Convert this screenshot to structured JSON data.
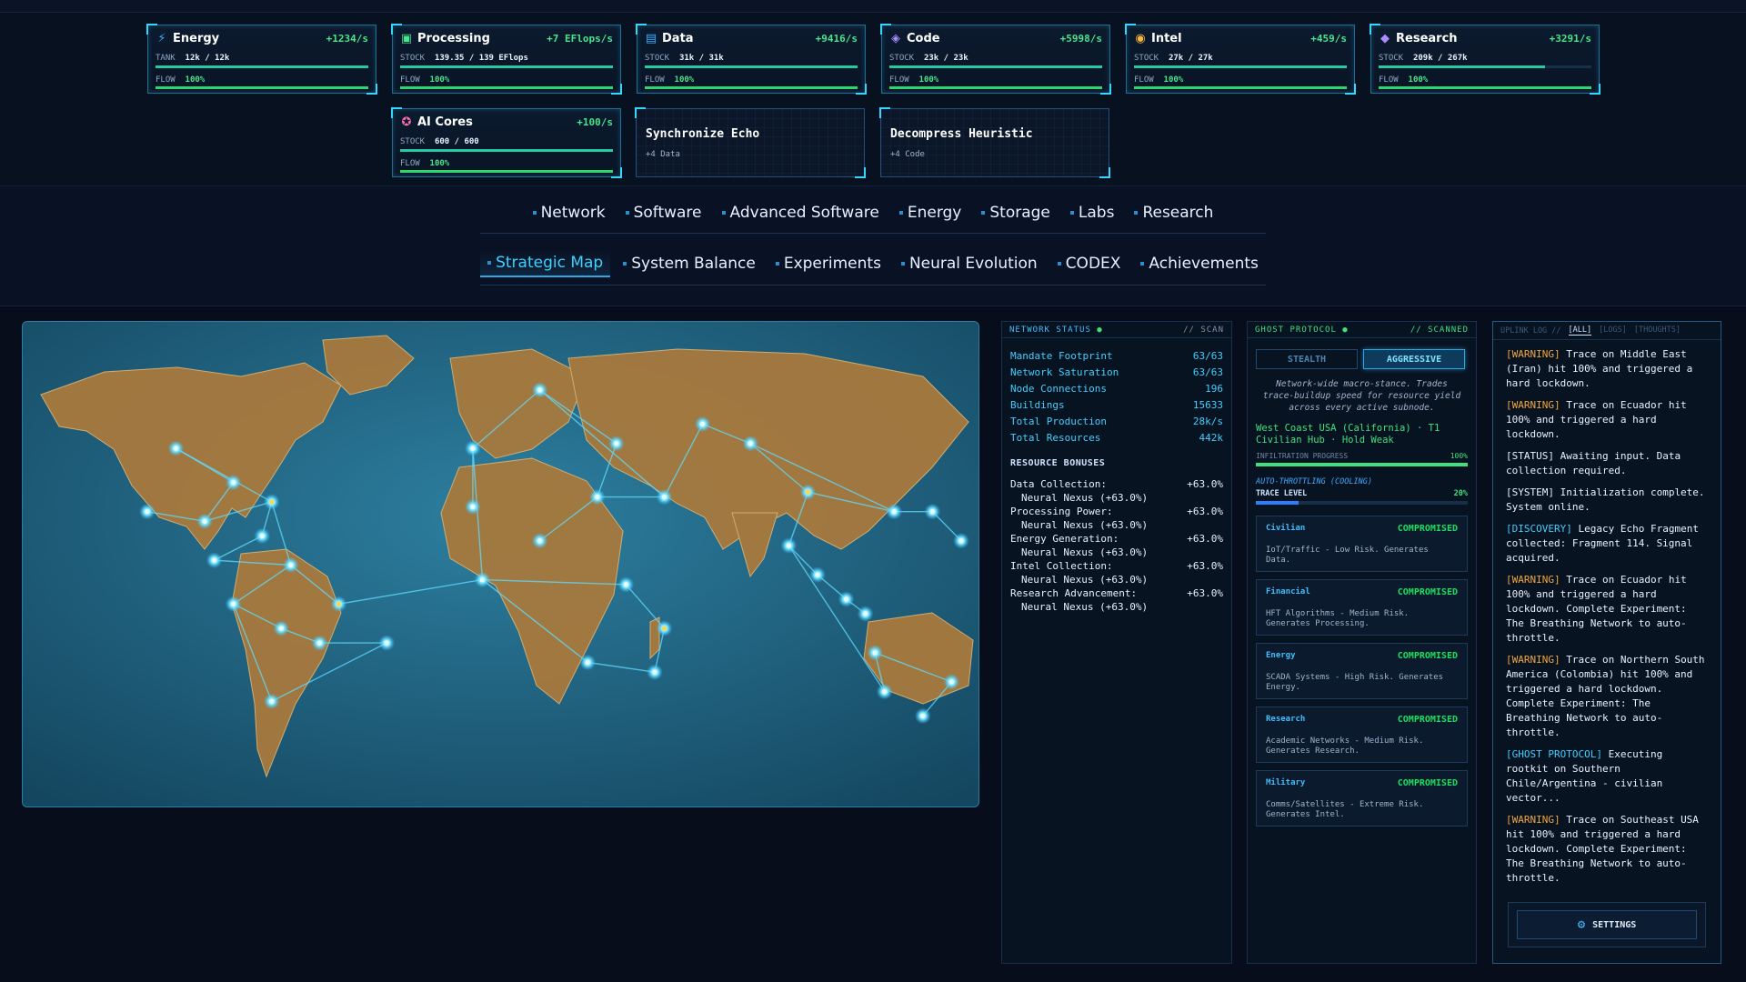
{
  "resources": [
    {
      "name": "Energy",
      "icon": "lightning-icon",
      "glyph": "⚡",
      "color": "#3fa9ff",
      "rate": "+1234/s",
      "stock_label": "TANK",
      "stock": "12k / 12k",
      "fill": 1.0,
      "flow_label": "FLOW",
      "flow": "100%"
    },
    {
      "name": "Processing",
      "icon": "chip-icon",
      "glyph": "▣",
      "color": "#4be38b",
      "rate": "+7 EFlops/s",
      "stock_label": "STOCK",
      "stock": "139.35 / 139 EFlops",
      "fill": 1.0,
      "flow_label": "FLOW",
      "flow": "100%"
    },
    {
      "name": "Data",
      "icon": "window-icon",
      "glyph": "▤",
      "color": "#3fa9ff",
      "rate": "+9416/s",
      "stock_label": "STOCK",
      "stock": "31k / 31k",
      "fill": 1.0,
      "flow_label": "FLOW",
      "flow": "100%"
    },
    {
      "name": "Code",
      "icon": "code-brackets-icon",
      "glyph": "◈",
      "color": "#a98bff",
      "rate": "+5998/s",
      "stock_label": "STOCK",
      "stock": "23k / 23k",
      "fill": 1.0,
      "flow_label": "FLOW",
      "flow": "100%"
    },
    {
      "name": "Intel",
      "icon": "target-icon",
      "glyph": "◉",
      "color": "#f5b93c",
      "rate": "+459/s",
      "stock_label": "STOCK",
      "stock": "27k / 27k",
      "fill": 1.0,
      "flow_label": "FLOW",
      "flow": "100%"
    },
    {
      "name": "Research",
      "icon": "layers-icon",
      "glyph": "◆",
      "color": "#a98bff",
      "rate": "+3291/s",
      "stock_label": "STOCK",
      "stock": "209k / 267k",
      "fill": 0.78,
      "flow_label": "FLOW",
      "flow": "100%"
    },
    {
      "name": "AI Cores",
      "icon": "brain-icon",
      "glyph": "✪",
      "color": "#ff6fb4",
      "rate": "+100/s",
      "stock_label": "STOCK",
      "stock": "600 / 600",
      "fill": 1.0,
      "flow_label": "FLOW",
      "flow": "100%"
    }
  ],
  "experiments": [
    {
      "title": "Synchronize Echo",
      "reward": "+4 Data"
    },
    {
      "title": "Decompress Heuristic",
      "reward": "+4 Code"
    }
  ],
  "nav_primary": [
    "Network",
    "Software",
    "Advanced Software",
    "Energy",
    "Storage",
    "Labs",
    "Research"
  ],
  "nav_secondary": [
    "Strategic Map",
    "System Balance",
    "Experiments",
    "Neural Evolution",
    "CODEX",
    "Achievements"
  ],
  "active_tab": "Strategic Map",
  "network_status": {
    "title": "NETWORK STATUS",
    "tag": "// SCAN",
    "stats": [
      {
        "label": "Mandate Footprint",
        "value": "63/63"
      },
      {
        "label": "Network Saturation",
        "value": "63/63"
      },
      {
        "label": "Node Connections",
        "value": "196"
      },
      {
        "label": "Buildings",
        "value": "15633"
      },
      {
        "label": "Total Production",
        "value": "28k/s"
      },
      {
        "label": "Total Resources",
        "value": "442k"
      }
    ],
    "bonus_title": "RESOURCE BONUSES",
    "bonuses": [
      {
        "label": "Data Collection:",
        "value": "+63.0%",
        "sub": "Neural Nexus (+63.0%)"
      },
      {
        "label": "Processing Power:",
        "value": "+63.0%",
        "sub": "Neural Nexus (+63.0%)"
      },
      {
        "label": "Energy Generation:",
        "value": "+63.0%",
        "sub": "Neural Nexus (+63.0%)"
      },
      {
        "label": "Intel Collection:",
        "value": "+63.0%",
        "sub": "Neural Nexus (+63.0%)"
      },
      {
        "label": "Research Advancement:",
        "value": "+63.0%",
        "sub": "Neural Nexus (+63.0%)"
      }
    ]
  },
  "ghost": {
    "title": "GHOST PROTOCOL",
    "tag": "// SCANNED",
    "stealth": "STEALTH",
    "aggressive": "AGGRESSIVE",
    "desc": "Network-wide macro-stance. Trades trace-buildup speed for resource yield across every active subnode.",
    "target": "West Coast USA (California) · T1 Civilian Hub · Hold Weak",
    "infiltration_label": "INFILTRATION PROGRESS",
    "infiltration": "100%",
    "infiltration_fill": 1.0,
    "throttle": "AUTO-THROTTLING (COOLING)",
    "trace_label": "TRACE LEVEL",
    "trace": "20%",
    "trace_fill": 0.2,
    "sectors": [
      {
        "name": "Civilian",
        "status": "COMPROMISED",
        "desc": "IoT/Traffic - Low Risk. Generates Data."
      },
      {
        "name": "Financial",
        "status": "COMPROMISED",
        "desc": "HFT Algorithms - Medium Risk. Generates Processing."
      },
      {
        "name": "Energy",
        "status": "COMPROMISED",
        "desc": "SCADA Systems - High Risk. Generates Energy."
      },
      {
        "name": "Research",
        "status": "COMPROMISED",
        "desc": "Academic Networks - Medium Risk. Generates Research."
      },
      {
        "name": "Military",
        "status": "COMPROMISED",
        "desc": "Comms/Satellites - Extreme Risk. Generates Intel."
      }
    ]
  },
  "uplink": {
    "title": "UPLINK LOG //",
    "tabs": [
      "[ALL]",
      "[LOGS]",
      "[THOUGHTS]"
    ],
    "entries": [
      {
        "tag": "[WARNING]",
        "type": "w",
        "text": "Trace on Middle East (Iran) hit 100% and triggered a hard lockdown."
      },
      {
        "tag": "[WARNING]",
        "type": "w",
        "text": "Trace on Ecuador hit 100% and triggered a hard lockdown."
      },
      {
        "tag": "[STATUS]",
        "type": "n",
        "text": "Awaiting input. Data collection required."
      },
      {
        "tag": "[SYSTEM]",
        "type": "n",
        "text": "Initialization complete. System online."
      },
      {
        "tag": "[DISCOVERY]",
        "type": "g",
        "text": "Legacy Echo Fragment collected: Fragment 114. Signal acquired."
      },
      {
        "tag": "[WARNING]",
        "type": "w",
        "text": "Trace on Ecuador hit 100% and triggered a hard lockdown. Complete Experiment: The Breathing Network to auto-throttle."
      },
      {
        "tag": "[WARNING]",
        "type": "w",
        "text": "Trace on Northern South America (Colombia) hit 100% and triggered a hard lockdown. Complete Experiment: The Breathing Network to auto-throttle."
      },
      {
        "tag": "[GHOST PROTOCOL]",
        "type": "g",
        "text": "Executing rootkit on Southern Chile/Argentina - civilian vector..."
      },
      {
        "tag": "[WARNING]",
        "type": "w",
        "text": "Trace on Southeast USA hit 100% and triggered a hard lockdown. Complete Experiment: The Breathing Network to auto-throttle."
      }
    ],
    "settings": "SETTINGS"
  },
  "map_nodes": [
    [
      0.16,
      0.26
    ],
    [
      0.22,
      0.33
    ],
    [
      0.13,
      0.39
    ],
    [
      0.19,
      0.41
    ],
    [
      0.26,
      0.37
    ],
    [
      0.25,
      0.44
    ],
    [
      0.2,
      0.49
    ],
    [
      0.28,
      0.5
    ],
    [
      0.22,
      0.58
    ],
    [
      0.27,
      0.63
    ],
    [
      0.31,
      0.66
    ],
    [
      0.26,
      0.78
    ],
    [
      0.38,
      0.66
    ],
    [
      0.33,
      0.58
    ],
    [
      0.48,
      0.53
    ],
    [
      0.47,
      0.26
    ],
    [
      0.54,
      0.14
    ],
    [
      0.62,
      0.25
    ],
    [
      0.6,
      0.36
    ],
    [
      0.67,
      0.36
    ],
    [
      0.71,
      0.21
    ],
    [
      0.76,
      0.25
    ],
    [
      0.82,
      0.35
    ],
    [
      0.8,
      0.46
    ],
    [
      0.83,
      0.52
    ],
    [
      0.86,
      0.57
    ],
    [
      0.88,
      0.6
    ],
    [
      0.91,
      0.39
    ],
    [
      0.95,
      0.39
    ],
    [
      0.98,
      0.45
    ],
    [
      0.63,
      0.54
    ],
    [
      0.67,
      0.63
    ],
    [
      0.66,
      0.72
    ],
    [
      0.59,
      0.7
    ],
    [
      0.9,
      0.76
    ],
    [
      0.89,
      0.68
    ],
    [
      0.97,
      0.74
    ],
    [
      0.94,
      0.81
    ],
    [
      0.54,
      0.45
    ],
    [
      0.47,
      0.38
    ]
  ],
  "map_links": [
    [
      0,
      1
    ],
    [
      1,
      3
    ],
    [
      3,
      2
    ],
    [
      3,
      4
    ],
    [
      4,
      5
    ],
    [
      5,
      6
    ],
    [
      6,
      7
    ],
    [
      7,
      8
    ],
    [
      8,
      9
    ],
    [
      9,
      10
    ],
    [
      10,
      12
    ],
    [
      12,
      11
    ],
    [
      8,
      11
    ],
    [
      13,
      7
    ],
    [
      13,
      14
    ],
    [
      14,
      15
    ],
    [
      15,
      16
    ],
    [
      16,
      17
    ],
    [
      17,
      18
    ],
    [
      18,
      19
    ],
    [
      19,
      20
    ],
    [
      20,
      21
    ],
    [
      21,
      22
    ],
    [
      22,
      23
    ],
    [
      23,
      24
    ],
    [
      24,
      25
    ],
    [
      25,
      26
    ],
    [
      22,
      27
    ],
    [
      27,
      28
    ],
    [
      28,
      29
    ],
    [
      23,
      34
    ],
    [
      34,
      35
    ],
    [
      35,
      36
    ],
    [
      36,
      37
    ],
    [
      14,
      30
    ],
    [
      30,
      31
    ],
    [
      31,
      32
    ],
    [
      32,
      33
    ],
    [
      33,
      14
    ],
    [
      38,
      18
    ],
    [
      39,
      15
    ],
    [
      0,
      4
    ],
    [
      4,
      7
    ],
    [
      16,
      19
    ],
    [
      21,
      27
    ]
  ]
}
